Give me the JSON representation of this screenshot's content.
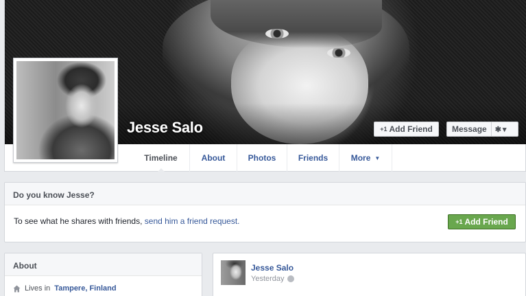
{
  "profile": {
    "name": "Jesse Salo"
  },
  "cover_actions": {
    "add_friend_icon": "+1",
    "add_friend_label": "Add Friend",
    "message_label": "Message",
    "settings_icon": "gear-icon",
    "settings_glyph": "✱",
    "caret_glyph": "▾"
  },
  "tabs": [
    {
      "label": "Timeline",
      "active": true
    },
    {
      "label": "About",
      "active": false
    },
    {
      "label": "Photos",
      "active": false
    },
    {
      "label": "Friends",
      "active": false
    },
    {
      "label": "More",
      "active": false
    }
  ],
  "more_caret": "▼",
  "know_box": {
    "heading": "Do you know Jesse?",
    "text": "To see what he shares with friends, ",
    "link": "send him a friend request.",
    "button_icon": "+1",
    "button_label": "Add Friend"
  },
  "about": {
    "heading": "About",
    "lives_prefix": "Lives in",
    "city": "Tampere, Finland"
  },
  "post": {
    "author": "Jesse Salo",
    "time": "Yesterday"
  },
  "colors": {
    "link": "#365899",
    "green_button": "#69a74e",
    "background": "#e9ebee"
  }
}
